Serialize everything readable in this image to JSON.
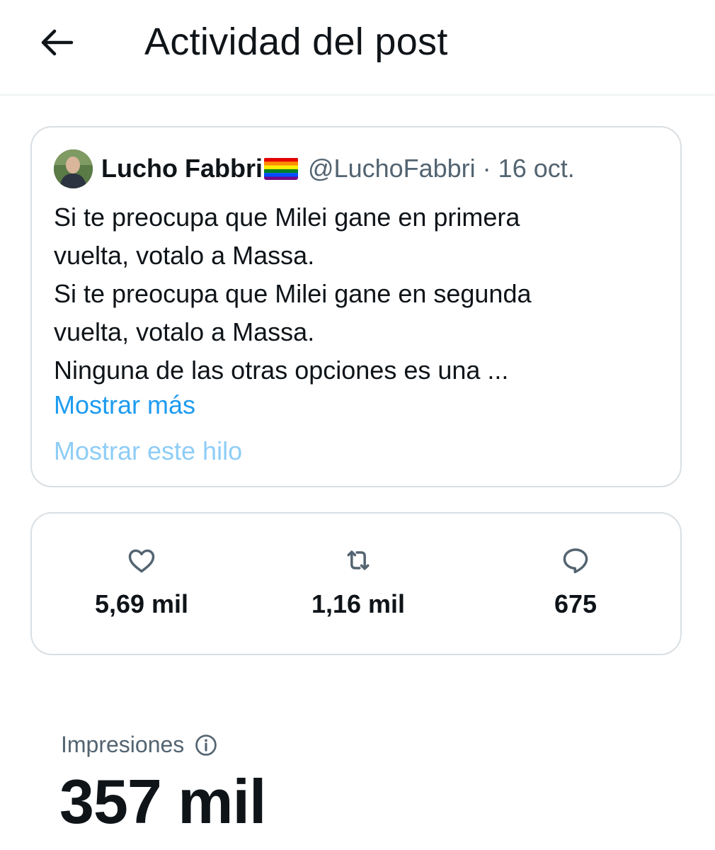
{
  "header": {
    "title": "Actividad del post",
    "back_icon": "arrow-left-icon"
  },
  "tweet": {
    "author_name": "Lucho Fabbri",
    "flag_icon": "rainbow-flag-icon",
    "handle": "@LuchoFabbri",
    "separator": "·",
    "date": "16 oct.",
    "text_lines": [
      "Si te preocupa que Milei gane en primera",
      "vuelta, votalo a Massa.",
      "Si te preocupa que Milei gane en segunda",
      "vuelta, votalo a Massa.",
      "Ninguna de las otras opciones es una ..."
    ],
    "show_more": "Mostrar más",
    "show_thread": "Mostrar este hilo"
  },
  "stats": {
    "likes": {
      "icon": "heart-icon",
      "value": "5,69 mil"
    },
    "reposts": {
      "icon": "repost-icon",
      "value": "1,16 mil"
    },
    "replies": {
      "icon": "reply-icon",
      "value": "675"
    }
  },
  "impressions": {
    "label": "Impresiones",
    "info_icon": "info-icon",
    "value": "357 mil"
  },
  "colors": {
    "text": "#0f1419",
    "secondary": "#536471",
    "link": "#1d9bf0",
    "link_faded": "#8ecdf7",
    "border": "#d9dfe3"
  }
}
